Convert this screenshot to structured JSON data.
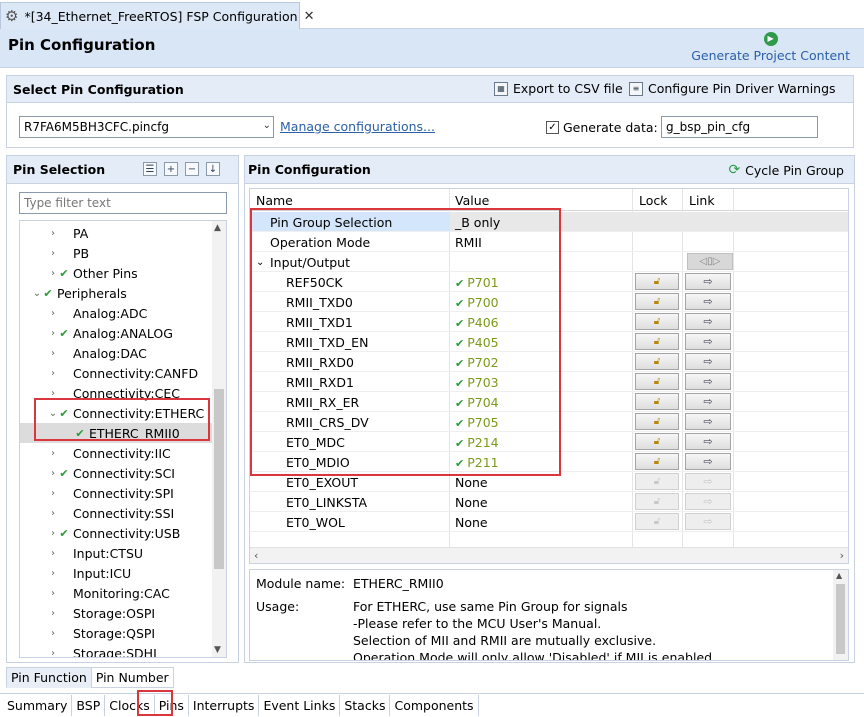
{
  "editor_tab": {
    "title": "*[34_Ethernet_FreeRTOS] FSP Configuration",
    "close": "✕"
  },
  "header": {
    "title": "Pin Configuration",
    "generate_label": "Generate Project Content"
  },
  "select_section": {
    "title": "Select Pin Configuration",
    "export_label": "Export to CSV file",
    "driver_warnings_label": "Configure Pin Driver Warnings",
    "config_file": "R7FA6M5BH3CFC.pincfg",
    "manage_link": "Manage configurations...",
    "generate_data_label": "Generate data:",
    "generate_data_checked": true,
    "generate_data_value": "g_bsp_pin_cfg"
  },
  "pin_selection": {
    "title": "Pin Selection",
    "filter_placeholder": "Type filter text",
    "tree": [
      {
        "label": "PA",
        "arrow": "›",
        "check": false,
        "indent": 1
      },
      {
        "label": "PB",
        "arrow": "›",
        "check": false,
        "indent": 1
      },
      {
        "label": "Other Pins",
        "arrow": "›",
        "check": true,
        "indent": 1
      },
      {
        "label": "Peripherals",
        "arrow": "⌄",
        "check": true,
        "indent": 0
      },
      {
        "label": "Analog:ADC",
        "arrow": "›",
        "check": false,
        "indent": 1
      },
      {
        "label": "Analog:ANALOG",
        "arrow": "›",
        "check": true,
        "indent": 1
      },
      {
        "label": "Analog:DAC",
        "arrow": "›",
        "check": false,
        "indent": 1
      },
      {
        "label": "Connectivity:CANFD",
        "arrow": "›",
        "check": false,
        "indent": 1
      },
      {
        "label": "Connectivity:CEC",
        "arrow": "›",
        "check": false,
        "indent": 1
      },
      {
        "label": "Connectivity:ETHERC",
        "arrow": "⌄",
        "check": true,
        "indent": 1
      },
      {
        "label": "ETHERC_RMII0",
        "arrow": "",
        "check": true,
        "indent": 2,
        "selected": true
      },
      {
        "label": "Connectivity:IIC",
        "arrow": "›",
        "check": false,
        "indent": 1
      },
      {
        "label": "Connectivity:SCI",
        "arrow": "›",
        "check": true,
        "indent": 1
      },
      {
        "label": "Connectivity:SPI",
        "arrow": "›",
        "check": false,
        "indent": 1
      },
      {
        "label": "Connectivity:SSI",
        "arrow": "›",
        "check": false,
        "indent": 1
      },
      {
        "label": "Connectivity:USB",
        "arrow": "›",
        "check": true,
        "indent": 1
      },
      {
        "label": "Input:CTSU",
        "arrow": "›",
        "check": false,
        "indent": 1
      },
      {
        "label": "Input:ICU",
        "arrow": "›",
        "check": false,
        "indent": 1
      },
      {
        "label": "Monitoring:CAC",
        "arrow": "›",
        "check": false,
        "indent": 1
      },
      {
        "label": "Storage:OSPI",
        "arrow": "›",
        "check": false,
        "indent": 1
      },
      {
        "label": "Storage:QSPI",
        "arrow": "›",
        "check": false,
        "indent": 1
      },
      {
        "label": "Storage:SDHI",
        "arrow": "›",
        "check": false,
        "indent": 1
      }
    ]
  },
  "pin_configuration": {
    "title": "Pin Configuration",
    "cycle_label": "Cycle Pin Group",
    "columns": [
      "Name",
      "Value",
      "Lock",
      "Link"
    ],
    "rows": [
      {
        "name": "Pin Group Selection",
        "value": "_B only",
        "indent": 1,
        "kind": "plain",
        "selected": true
      },
      {
        "name": "Operation Mode",
        "value": "RMII",
        "indent": 1,
        "kind": "plain"
      },
      {
        "name": "Input/Output",
        "value": "",
        "indent": 0,
        "kind": "group"
      },
      {
        "name": "REF50CK",
        "value": "P701",
        "indent": 2,
        "kind": "pin"
      },
      {
        "name": "RMII_TXD0",
        "value": "P700",
        "indent": 2,
        "kind": "pin"
      },
      {
        "name": "RMII_TXD1",
        "value": "P406",
        "indent": 2,
        "kind": "pin"
      },
      {
        "name": "RMII_TXD_EN",
        "value": "P405",
        "indent": 2,
        "kind": "pin"
      },
      {
        "name": "RMII_RXD0",
        "value": "P702",
        "indent": 2,
        "kind": "pin"
      },
      {
        "name": "RMII_RXD1",
        "value": "P703",
        "indent": 2,
        "kind": "pin"
      },
      {
        "name": "RMII_RX_ER",
        "value": "P704",
        "indent": 2,
        "kind": "pin"
      },
      {
        "name": "RMII_CRS_DV",
        "value": "P705",
        "indent": 2,
        "kind": "pin"
      },
      {
        "name": "ET0_MDC",
        "value": "P214",
        "indent": 2,
        "kind": "pin"
      },
      {
        "name": "ET0_MDIO",
        "value": "P211",
        "indent": 2,
        "kind": "pin"
      },
      {
        "name": "ET0_EXOUT",
        "value": "None",
        "indent": 2,
        "kind": "none"
      },
      {
        "name": "ET0_LINKSTA",
        "value": "None",
        "indent": 2,
        "kind": "none"
      },
      {
        "name": "ET0_WOL",
        "value": "None",
        "indent": 2,
        "kind": "none"
      }
    ],
    "info": {
      "module_name_label": "Module name:",
      "module_name": "ETHERC_RMII0",
      "usage_label": "Usage:",
      "usage_lines": [
        "For ETHERC, use same Pin Group for signals",
        "-Please refer to the MCU User's Manual.",
        "Selection of MII and RMII are mutually exclusive.",
        "Operation Mode will only allow 'Disabled' if MII is enabled."
      ]
    }
  },
  "sub_tabs": [
    "Pin Function",
    "Pin Number"
  ],
  "bottom_tabs": [
    "Summary",
    "BSP",
    "Clocks",
    "Pins",
    "Interrupts",
    "Event Links",
    "Stacks",
    "Components"
  ],
  "colors": {
    "highlight": "#d9363e",
    "check": "#2a9a3a",
    "link": "#2b5fa8",
    "pin_value": "#7a9a1a"
  }
}
